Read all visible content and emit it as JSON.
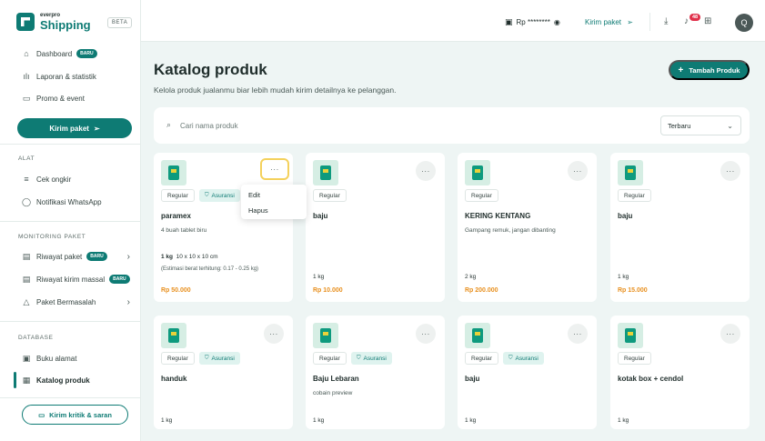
{
  "brand": {
    "small": "everpro",
    "name": "Shipping",
    "beta": "BETA"
  },
  "nav": {
    "dashboard": "Dashboard",
    "dashboard_badge": "BARU",
    "laporan": "Laporan & statistik",
    "promo": "Promo & event",
    "kirim": "Kirim paket",
    "alat_label": "ALAT",
    "cek_ongkir": "Cek ongkir",
    "notif_wa": "Notifikasi WhatsApp",
    "monitoring_label": "MONITORING PAKET",
    "riwayat": "Riwayat paket",
    "riwayat_badge": "BARU",
    "riwayat_massal": "Riwayat kirim massal",
    "riwayat_massal_badge": "BARU",
    "bermasalah": "Paket Bermasalah",
    "database_label": "DATABASE",
    "buku_alamat": "Buku alamat",
    "katalog": "Katalog produk",
    "feedback": "Kirim kritik & saran"
  },
  "topbar": {
    "saldo": "Rp ********",
    "kirim": "Kirim paket",
    "notif_count": "48",
    "avatar": "Q"
  },
  "page": {
    "title": "Katalog produk",
    "subtitle": "Kelola produk jualanmu biar lebih mudah kirim detailnya ke pelanggan.",
    "add_button": "Tambah Produk",
    "search_placeholder": "Cari nama produk",
    "sort": "Terbaru"
  },
  "menu": {
    "edit": "Edit",
    "hapus": "Hapus"
  },
  "labels": {
    "regular": "Regular",
    "asuransi": "Asuransi",
    "more": "···"
  },
  "products": [
    {
      "name": "paramex",
      "desc": "4 buah tablet biru",
      "weight": "1 kg",
      "dims": "10 x 10 x 10 cm",
      "est": "(Estimasi berat terhitung: 0.17 - 0.25 kg)",
      "price": "Rp 50.000"
    },
    {
      "name": "baju",
      "desc": "",
      "weight": "1 kg",
      "price": "Rp 10.000"
    },
    {
      "name": "KERING KENTANG",
      "desc": "Gampang remuk, jangan dibanting",
      "weight": "2 kg",
      "price": "Rp 200.000"
    },
    {
      "name": "baju",
      "desc": "",
      "weight": "1 kg",
      "price": "Rp 15.000"
    },
    {
      "name": "handuk",
      "desc": "",
      "weight": "1 kg"
    },
    {
      "name": "Baju Lebaran",
      "desc": "cobain preview",
      "weight": "1 kg"
    },
    {
      "name": "baju",
      "desc": "",
      "weight": "1 kg"
    },
    {
      "name": "kotak box + cendol",
      "desc": "",
      "weight": "1 kg"
    }
  ]
}
